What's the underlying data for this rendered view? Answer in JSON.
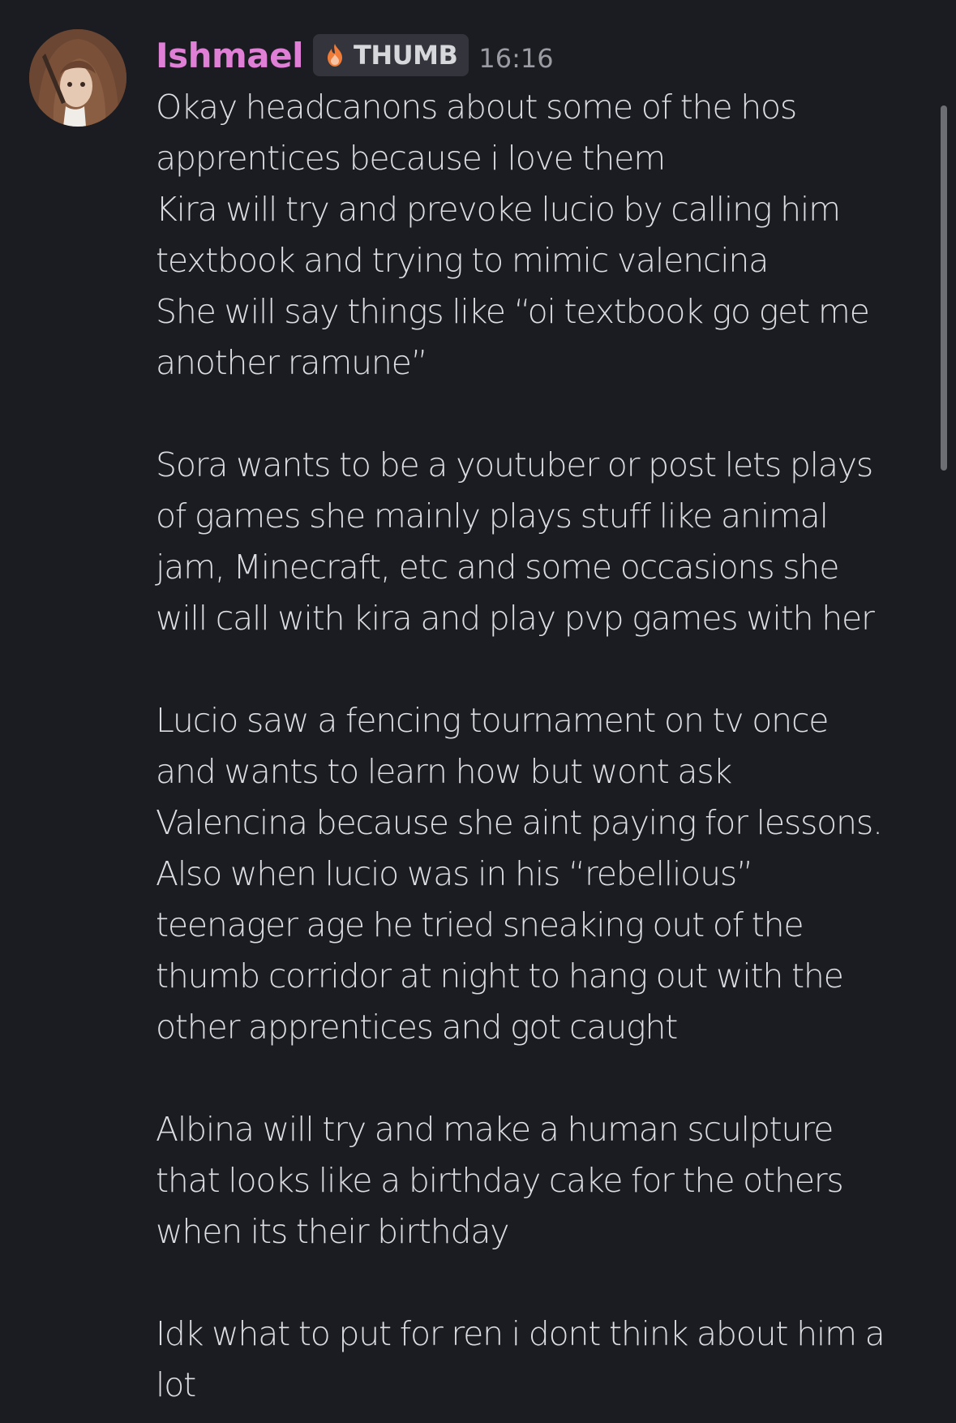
{
  "message": {
    "author": "Ishmael",
    "tag": {
      "label": "THUMB",
      "icon": "flame-icon"
    },
    "timestamp": "16:16",
    "lines": [
      "Okay headcanons about some of the hos",
      "apprentices because i love them",
      "Kira will try and prevoke lucio by calling him",
      "textbook and trying to mimic valencina",
      "She will say things like “oi textbook go get me",
      "another ramune”",
      "",
      "Sora wants to be a youtuber or post lets plays",
      "of games she mainly plays stuff like animal",
      "jam, Minecraft, etc and some occasions she",
      "will call with kira and play pvp games with her",
      "",
      "Lucio saw a fencing tournament on tv once",
      "and wants to learn how but wont ask",
      "Valencina because she aint paying for lessons.",
      "Also when lucio was in his “rebellious”",
      "teenager age he tried sneaking out of the",
      "thumb corridor at night to hang out with the",
      "other apprentices and got caught",
      "",
      "Albina will try and make a human sculpture",
      "that looks like a birthday cake for the others",
      "when its their birthday",
      "",
      "Idk what to put for ren i dont think about him a",
      "lot"
    ]
  },
  "colors": {
    "background": "#1b1c21",
    "username": "#e07fd6",
    "text": "#dcdde2",
    "timestamp": "#9a9ba3",
    "tag_background": "#34353c"
  }
}
